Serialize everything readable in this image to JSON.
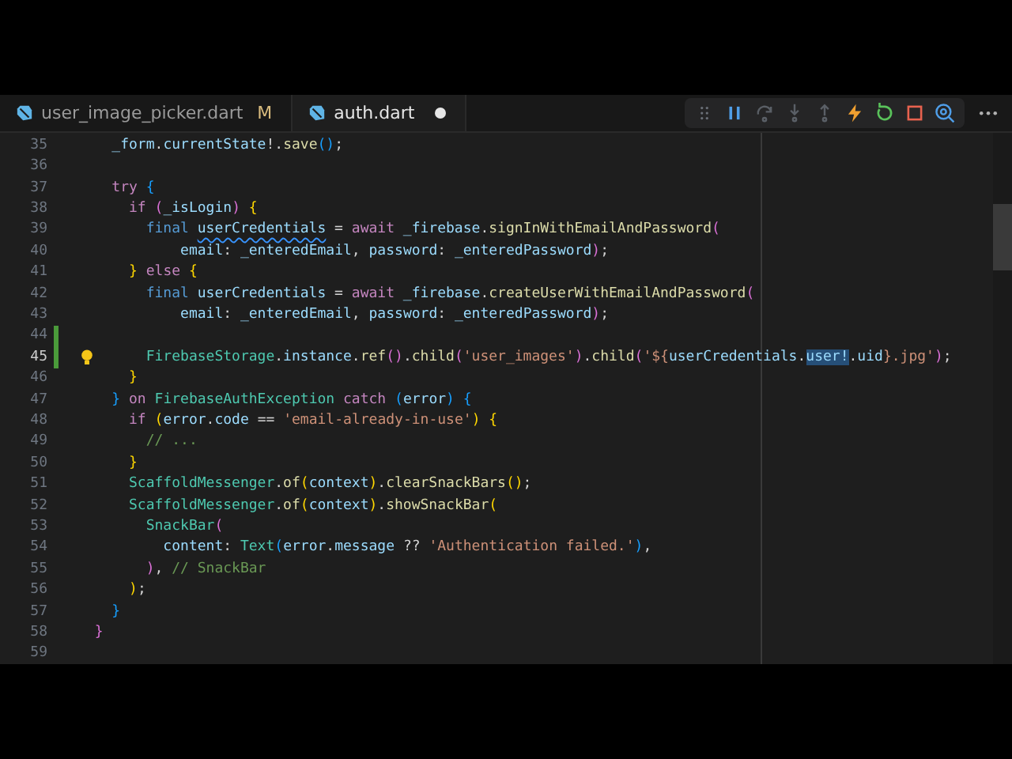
{
  "tabs": [
    {
      "label": "user_image_picker.dart",
      "selected": false,
      "status": "M",
      "dirty": false
    },
    {
      "label": "auth.dart",
      "selected": true,
      "dirty": true
    }
  ],
  "debug_toolbar": [
    {
      "kind": "pause",
      "disabled": false
    },
    {
      "kind": "step-over",
      "disabled": true
    },
    {
      "kind": "step-into",
      "disabled": true
    },
    {
      "kind": "step-out",
      "disabled": true
    },
    {
      "kind": "hot-reload",
      "disabled": false
    },
    {
      "kind": "restart",
      "disabled": false
    },
    {
      "kind": "stop",
      "disabled": false
    },
    {
      "kind": "inspect",
      "disabled": false
    }
  ],
  "editor": {
    "lines": [
      {
        "number": "35",
        "modified": false,
        "lightbulb": false,
        "tokens": [
          {
            "kind": "variable",
            "text": "    _form"
          },
          {
            "kind": "plain",
            "text": "."
          },
          {
            "kind": "variable",
            "text": "currentState"
          },
          {
            "kind": "plain",
            "text": "!."
          },
          {
            "kind": "function",
            "text": "save"
          },
          {
            "kind": "bracket3",
            "text": "()"
          },
          {
            "kind": "plain",
            "text": ";"
          }
        ]
      },
      {
        "number": "36",
        "modified": false,
        "lightbulb": false
      },
      {
        "number": "37",
        "modified": false,
        "lightbulb": false,
        "tokens": [
          {
            "kind": "keyword",
            "text": "    try "
          },
          {
            "kind": "bracket3",
            "text": "{"
          }
        ]
      },
      {
        "number": "38",
        "modified": false,
        "lightbulb": false,
        "tokens": [
          {
            "kind": "keyword",
            "text": "      if "
          },
          {
            "kind": "bracket2",
            "text": "("
          },
          {
            "kind": "variable",
            "text": "_isLogin"
          },
          {
            "kind": "bracket2",
            "text": ") "
          },
          {
            "kind": "bracket1",
            "text": "{"
          }
        ]
      },
      {
        "number": "39",
        "modified": false,
        "lightbulb": false,
        "tokens": [
          {
            "kind": "storage",
            "text": "        final "
          },
          {
            "kind": "warning",
            "text": "userCredentials"
          },
          {
            "kind": "plain",
            "text": " = "
          },
          {
            "kind": "keyword",
            "text": "await "
          },
          {
            "kind": "variable",
            "text": "_firebase"
          },
          {
            "kind": "plain",
            "text": "."
          },
          {
            "kind": "function",
            "text": "signInWithEmailAndPassword"
          },
          {
            "kind": "bracket2",
            "text": "("
          }
        ]
      },
      {
        "number": "40",
        "modified": false,
        "lightbulb": false,
        "tokens": [
          {
            "kind": "variable",
            "text": "            email"
          },
          {
            "kind": "plain",
            "text": ": "
          },
          {
            "kind": "variable",
            "text": "_enteredEmail"
          },
          {
            "kind": "plain",
            "text": ", "
          },
          {
            "kind": "variable",
            "text": "password"
          },
          {
            "kind": "plain",
            "text": ": "
          },
          {
            "kind": "variable",
            "text": "_enteredPassword"
          },
          {
            "kind": "bracket2",
            "text": ")"
          },
          {
            "kind": "plain",
            "text": ";"
          }
        ]
      },
      {
        "number": "41",
        "modified": false,
        "lightbulb": false,
        "tokens": [
          {
            "kind": "bracket1",
            "text": "      } "
          },
          {
            "kind": "keyword",
            "text": "else "
          },
          {
            "kind": "bracket1",
            "text": "{"
          }
        ]
      },
      {
        "number": "42",
        "modified": false,
        "lightbulb": false,
        "tokens": [
          {
            "kind": "storage",
            "text": "        final "
          },
          {
            "kind": "variable",
            "text": "userCredentials"
          },
          {
            "kind": "plain",
            "text": " = "
          },
          {
            "kind": "keyword",
            "text": "await "
          },
          {
            "kind": "variable",
            "text": "_firebase"
          },
          {
            "kind": "plain",
            "text": "."
          },
          {
            "kind": "function",
            "text": "createUserWithEmailAndPassword"
          },
          {
            "kind": "bracket2",
            "text": "("
          }
        ]
      },
      {
        "number": "43",
        "modified": false,
        "lightbulb": false,
        "tokens": [
          {
            "kind": "variable",
            "text": "            email"
          },
          {
            "kind": "plain",
            "text": ": "
          },
          {
            "kind": "variable",
            "text": "_enteredEmail"
          },
          {
            "kind": "plain",
            "text": ", "
          },
          {
            "kind": "variable",
            "text": "password"
          },
          {
            "kind": "plain",
            "text": ": "
          },
          {
            "kind": "variable",
            "text": "_enteredPassword"
          },
          {
            "kind": "bracket2",
            "text": ")"
          },
          {
            "kind": "plain",
            "text": ";"
          }
        ]
      },
      {
        "number": "44",
        "modified": true,
        "lightbulb": false
      },
      {
        "number": "45",
        "modified": true,
        "lightbulb": true,
        "tokens": [
          {
            "kind": "type",
            "text": "        FirebaseStorage"
          },
          {
            "kind": "plain",
            "text": "."
          },
          {
            "kind": "variable",
            "text": "instance"
          },
          {
            "kind": "plain",
            "text": "."
          },
          {
            "kind": "function",
            "text": "ref"
          },
          {
            "kind": "bracket2",
            "text": "()"
          },
          {
            "kind": "plain",
            "text": "."
          },
          {
            "kind": "function",
            "text": "child"
          },
          {
            "kind": "bracket2",
            "text": "("
          },
          {
            "kind": "string",
            "text": "'user_images'"
          },
          {
            "kind": "bracket2",
            "text": ")"
          },
          {
            "kind": "plain",
            "text": "."
          },
          {
            "kind": "function",
            "text": "child"
          },
          {
            "kind": "bracket2",
            "text": "("
          },
          {
            "kind": "string",
            "text": "'${"
          },
          {
            "kind": "variable",
            "text": "userCredentials"
          },
          {
            "kind": "plain",
            "text": "."
          },
          {
            "kind": "selection",
            "text": "user!"
          },
          {
            "kind": "plain",
            "text": "."
          },
          {
            "kind": "variable",
            "text": "uid"
          },
          {
            "kind": "string",
            "text": "}.jpg'"
          },
          {
            "kind": "bracket2",
            "text": ")"
          },
          {
            "kind": "plain",
            "text": ";"
          }
        ]
      },
      {
        "number": "46",
        "modified": false,
        "lightbulb": false,
        "tokens": [
          {
            "kind": "bracket1",
            "text": "      }"
          }
        ]
      },
      {
        "number": "47",
        "modified": false,
        "lightbulb": false,
        "tokens": [
          {
            "kind": "bracket3",
            "text": "    } "
          },
          {
            "kind": "keyword",
            "text": "on "
          },
          {
            "kind": "type",
            "text": "FirebaseAuthException "
          },
          {
            "kind": "keyword",
            "text": "catch "
          },
          {
            "kind": "bracket3",
            "text": "("
          },
          {
            "kind": "variable",
            "text": "error"
          },
          {
            "kind": "bracket3",
            "text": ") {"
          }
        ]
      },
      {
        "number": "48",
        "modified": false,
        "lightbulb": false,
        "tokens": [
          {
            "kind": "keyword",
            "text": "      if "
          },
          {
            "kind": "bracket1",
            "text": "("
          },
          {
            "kind": "variable",
            "text": "error"
          },
          {
            "kind": "plain",
            "text": "."
          },
          {
            "kind": "variable",
            "text": "code"
          },
          {
            "kind": "plain",
            "text": " == "
          },
          {
            "kind": "string",
            "text": "'email-already-in-use'"
          },
          {
            "kind": "bracket1",
            "text": ") {"
          }
        ]
      },
      {
        "number": "49",
        "modified": false,
        "lightbulb": false,
        "tokens": [
          {
            "kind": "comment",
            "text": "        // ..."
          }
        ]
      },
      {
        "number": "50",
        "modified": false,
        "lightbulb": false,
        "tokens": [
          {
            "kind": "bracket1",
            "text": "      }"
          }
        ]
      },
      {
        "number": "51",
        "modified": false,
        "lightbulb": false,
        "tokens": [
          {
            "kind": "type",
            "text": "      ScaffoldMessenger"
          },
          {
            "kind": "plain",
            "text": "."
          },
          {
            "kind": "function",
            "text": "of"
          },
          {
            "kind": "bracket1",
            "text": "("
          },
          {
            "kind": "variable",
            "text": "context"
          },
          {
            "kind": "bracket1",
            "text": ")"
          },
          {
            "kind": "plain",
            "text": "."
          },
          {
            "kind": "function",
            "text": "clearSnackBars"
          },
          {
            "kind": "bracket1",
            "text": "()"
          },
          {
            "kind": "plain",
            "text": ";"
          }
        ]
      },
      {
        "number": "52",
        "modified": false,
        "lightbulb": false,
        "tokens": [
          {
            "kind": "type",
            "text": "      ScaffoldMessenger"
          },
          {
            "kind": "plain",
            "text": "."
          },
          {
            "kind": "function",
            "text": "of"
          },
          {
            "kind": "bracket1",
            "text": "("
          },
          {
            "kind": "variable",
            "text": "context"
          },
          {
            "kind": "bracket1",
            "text": ")"
          },
          {
            "kind": "plain",
            "text": "."
          },
          {
            "kind": "function",
            "text": "showSnackBar"
          },
          {
            "kind": "bracket1",
            "text": "("
          }
        ]
      },
      {
        "number": "53",
        "modified": false,
        "lightbulb": false,
        "tokens": [
          {
            "kind": "type",
            "text": "        SnackBar"
          },
          {
            "kind": "bracket2",
            "text": "("
          }
        ]
      },
      {
        "number": "54",
        "modified": false,
        "lightbulb": false,
        "tokens": [
          {
            "kind": "variable",
            "text": "          content"
          },
          {
            "kind": "plain",
            "text": ": "
          },
          {
            "kind": "type",
            "text": "Text"
          },
          {
            "kind": "bracket3",
            "text": "("
          },
          {
            "kind": "variable",
            "text": "error"
          },
          {
            "kind": "plain",
            "text": "."
          },
          {
            "kind": "variable",
            "text": "message"
          },
          {
            "kind": "plain",
            "text": " ?? "
          },
          {
            "kind": "string",
            "text": "'Authentication failed.'"
          },
          {
            "kind": "bracket3",
            "text": ")"
          },
          {
            "kind": "plain",
            "text": ","
          }
        ]
      },
      {
        "number": "55",
        "modified": false,
        "lightbulb": false,
        "tokens": [
          {
            "kind": "bracket2",
            "text": "        )"
          },
          {
            "kind": "plain",
            "text": ", "
          },
          {
            "kind": "comment",
            "text": "// SnackBar"
          }
        ]
      },
      {
        "number": "56",
        "modified": false,
        "lightbulb": false,
        "tokens": [
          {
            "kind": "bracket1",
            "text": "      )"
          },
          {
            "kind": "plain",
            "text": ";"
          }
        ]
      },
      {
        "number": "57",
        "modified": false,
        "lightbulb": false,
        "tokens": [
          {
            "kind": "bracket3",
            "text": "    }"
          }
        ]
      },
      {
        "number": "58",
        "modified": false,
        "lightbulb": false,
        "tokens": [
          {
            "kind": "bracket2",
            "text": "  }"
          }
        ]
      },
      {
        "number": "59",
        "modified": false,
        "lightbulb": false
      }
    ]
  }
}
